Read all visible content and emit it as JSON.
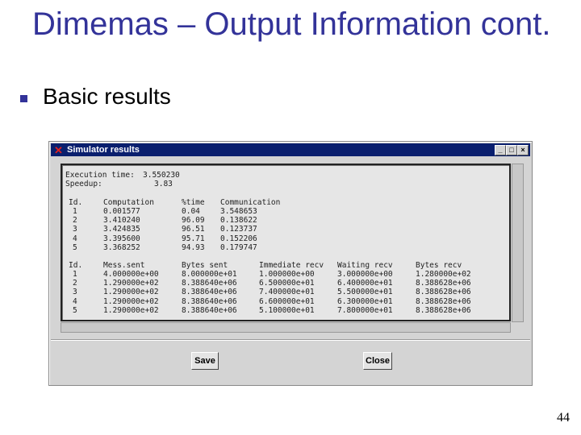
{
  "slide": {
    "title": "Dimemas – Output Information cont.",
    "bullet": "Basic results",
    "page_number": "44"
  },
  "window": {
    "title": "Simulator results",
    "controls": [
      "_",
      "□",
      "×"
    ],
    "execution_time_label": "Execution time:",
    "execution_time": "3.550230",
    "speedup_label": "Speedup:",
    "speedup": "3.83",
    "table1": {
      "headers": [
        "Id.",
        "Computation",
        "%time",
        "Communication"
      ],
      "rows": [
        [
          "1",
          "0.001577",
          "0.04",
          "3.548653"
        ],
        [
          "2",
          "3.410240",
          "96.09",
          "0.138622"
        ],
        [
          "3",
          "3.424835",
          "96.51",
          "0.123737"
        ],
        [
          "4",
          "3.395600",
          "95.71",
          "0.152206"
        ],
        [
          "5",
          "3.368252",
          "94.93",
          "0.179747"
        ]
      ]
    },
    "table2": {
      "headers": [
        "Id.",
        "Mess.sent",
        "Bytes sent",
        "Immediate recv",
        "Waiting recv",
        "Bytes recv"
      ],
      "rows": [
        [
          "1",
          "4.000000e+00",
          "8.000000e+01",
          "1.000000e+00",
          "3.000000e+00",
          "1.280000e+02"
        ],
        [
          "2",
          "1.290000e+02",
          "8.388640e+06",
          "6.500000e+01",
          "6.400000e+01",
          "8.388628e+06"
        ],
        [
          "3",
          "1.290000e+02",
          "8.388640e+06",
          "7.400000e+01",
          "5.500000e+01",
          "8.388628e+06"
        ],
        [
          "4",
          "1.290000e+02",
          "8.388640e+06",
          "6.600000e+01",
          "6.300000e+01",
          "8.388628e+06"
        ],
        [
          "5",
          "1.290000e+02",
          "8.388640e+06",
          "5.100000e+01",
          "7.800000e+01",
          "8.388628e+06"
        ]
      ]
    },
    "save_label": "Save",
    "close_label": "Close"
  }
}
